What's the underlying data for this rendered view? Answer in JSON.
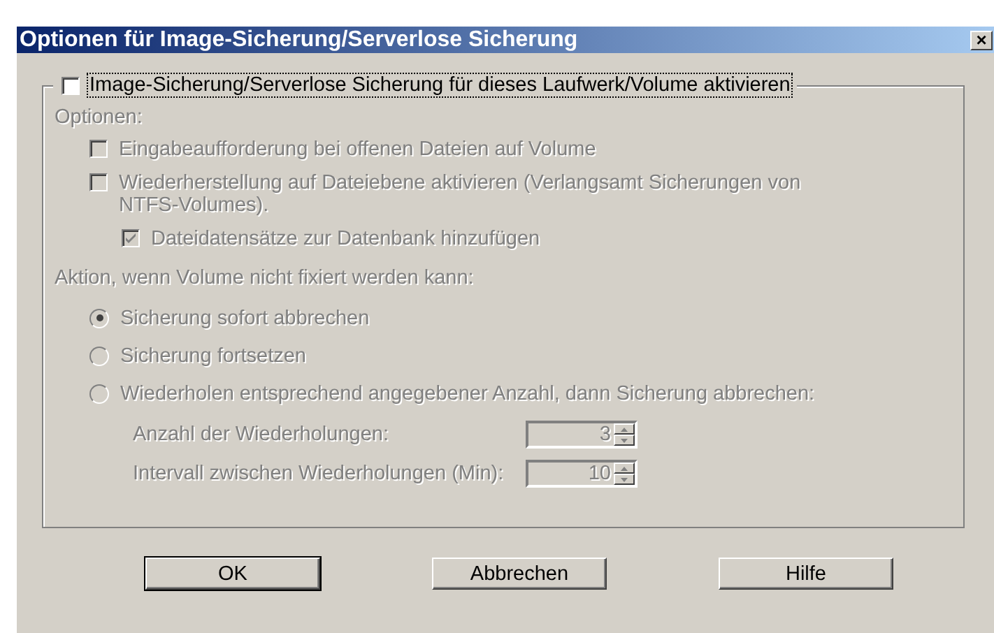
{
  "window": {
    "title": "Optionen für Image-Sicherung/Serverlose Sicherung",
    "close": "×"
  },
  "enable": {
    "label": "Image-Sicherung/Serverlose Sicherung für dieses Laufwerk/Volume aktivieren",
    "checked": false,
    "focused": true
  },
  "options_label": {
    "text": "Optionen:",
    "disabled": true
  },
  "options": [
    {
      "label": "Eingabeaufforderung bei offenen Dateien auf Volume",
      "checked": false,
      "disabled": true
    },
    {
      "label": "Wiederherstellung auf Dateiebene aktivieren (Verlangsamt Sicherungen von NTFS-Volumes).",
      "checked": false,
      "disabled": true,
      "children": [
        {
          "label": "Dateidatensätze zur Datenbank hinzufügen",
          "checked": true,
          "disabled": true
        }
      ]
    }
  ],
  "action_label": {
    "text": "Aktion, wenn Volume nicht fixiert werden kann:",
    "disabled": true
  },
  "radios": [
    {
      "label": "Sicherung sofort abbrechen",
      "selected": true,
      "disabled": true
    },
    {
      "label": "Sicherung fortsetzen",
      "selected": false,
      "disabled": true
    },
    {
      "label": "Wiederholen entsprechend angegebener Anzahl, dann Sicherung abbrechen:",
      "selected": false,
      "disabled": true
    }
  ],
  "spinners": [
    {
      "label": "Anzahl der Wiederholungen:",
      "value": "3",
      "disabled": true
    },
    {
      "label": "Intervall zwischen Wiederholungen (Min):",
      "value": "10",
      "disabled": true
    }
  ],
  "buttons": [
    {
      "label": "OK",
      "default": true
    },
    {
      "label": "Abbrechen",
      "default": false
    },
    {
      "label": "Hilfe",
      "default": false
    }
  ]
}
